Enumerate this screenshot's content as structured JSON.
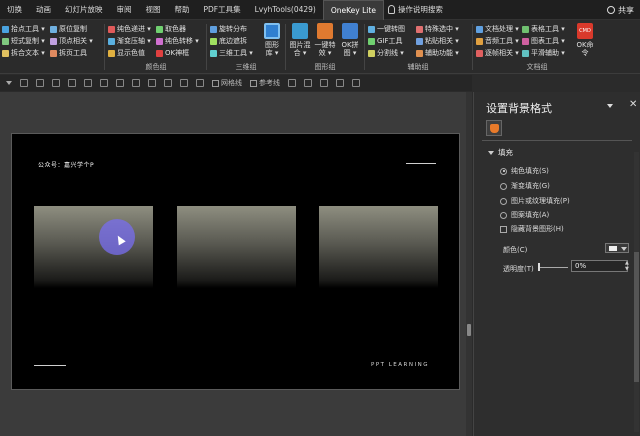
{
  "tabs": [
    "切换",
    "动画",
    "幻灯片放映",
    "审阅",
    "视图",
    "帮助",
    "PDF工具集",
    "LvyhTools(0429)",
    "OneKey Lite"
  ],
  "active_tab": "OneKey Lite",
  "search_label": "操作说明搜索",
  "share_label": "共享",
  "ribbon": {
    "g1": {
      "rows": [
        "拾点工具 ▾",
        "短式复制 ▾",
        "拆合文本 ▾"
      ],
      "rows2": [
        "原位复制",
        "顶点相关 ▾",
        "拆页工具"
      ],
      "label": ""
    },
    "g2": {
      "rows": [
        "纯色递进 ▾",
        "渐变压轴 ▾",
        "显示色值"
      ],
      "rows2": [
        "取色器",
        "纯色转移 ▾",
        "OK神框"
      ],
      "label": "颜色组"
    },
    "g3": {
      "rows": [
        "旋转分布",
        "底边遮拆",
        "三维工具 ▾"
      ],
      "big": "图形库 ▾",
      "label": "三维组"
    },
    "g4": {
      "big1": "图片混合 ▾",
      "big2": "一键特效 ▾",
      "big3": "OK拼图 ▾",
      "label": "图形组"
    },
    "g5": {
      "rows": [
        "一键转图",
        "GIF工具",
        "分割线 ▾"
      ],
      "rows2": [
        "特殊选中 ▾",
        "粘贴相关 ▾",
        "辅助功能 ▾"
      ],
      "label": "辅助组"
    },
    "g6": {
      "rows": [
        "文档处理 ▾",
        "音频工具 ▾",
        "逐帧相关 ▾"
      ],
      "rows2": [
        "表格工具 ▾",
        "图表工具 ▾",
        "平滑辅助 ▾"
      ],
      "big": "OK命令",
      "big_icon": "CMD",
      "label": "文档组"
    }
  },
  "quickbar": {
    "gridlines": "网格线",
    "guides": "参考线"
  },
  "slide": {
    "label": "公众号：嘉兴学个P",
    "brand": "PPT LEARNING"
  },
  "pane": {
    "title": "设置背景格式",
    "section": "填充",
    "options": [
      {
        "label": "纯色填充(S)",
        "selected": true
      },
      {
        "label": "渐变填充(G)",
        "selected": false
      },
      {
        "label": "图片或纹理填充(P)",
        "selected": false
      },
      {
        "label": "图案填充(A)",
        "selected": false
      }
    ],
    "hide_bg": "隐藏背景图形(H)",
    "color_label": "颜色(C)",
    "transparency_label": "透明度(T)",
    "transparency_value": "0%"
  },
  "colors": {
    "cursor_halo": "#786ef0",
    "fill_icon": "#e87a2a",
    "cmd_icon": "#d9392b"
  }
}
